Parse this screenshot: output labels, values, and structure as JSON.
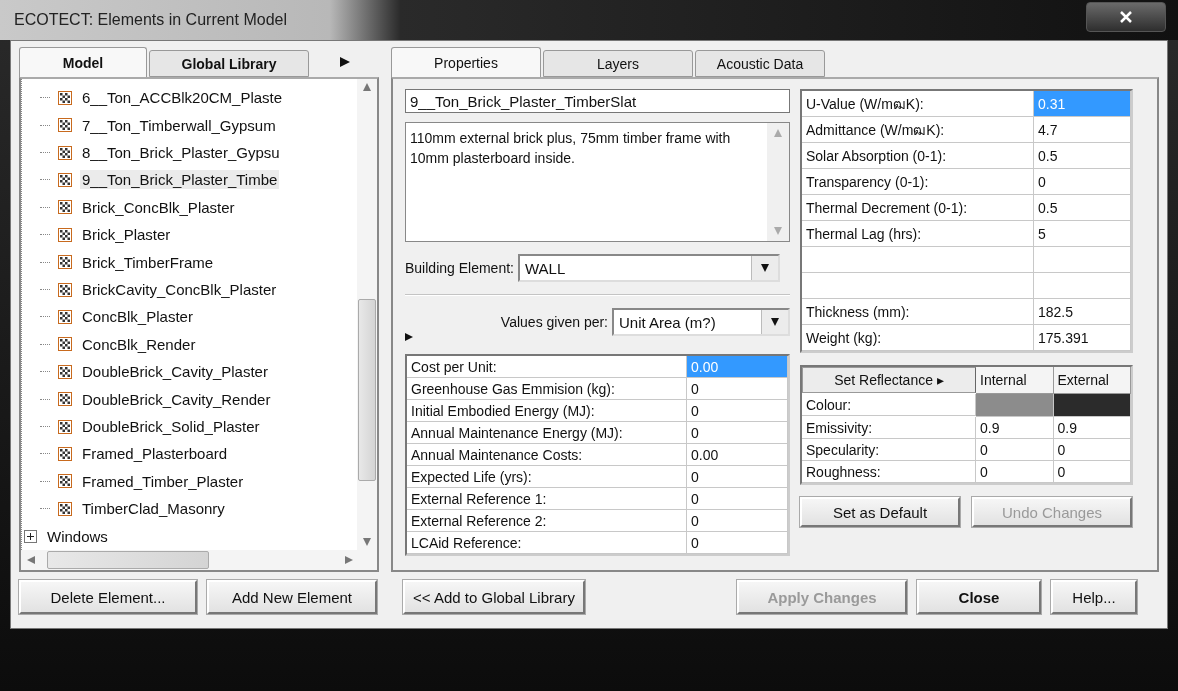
{
  "window": {
    "title": "ECOTECT: Elements in Current Model"
  },
  "left_tabs": [
    {
      "label": "Model",
      "selected": true
    },
    {
      "label": "Global Library",
      "selected": false
    }
  ],
  "tree": {
    "items": [
      {
        "kind": "element",
        "label": "6__Ton_ACCBlk20CM_Plaste",
        "selected": false
      },
      {
        "kind": "element",
        "label": "7__Ton_Timberwall_Gypsum",
        "selected": false
      },
      {
        "kind": "element",
        "label": "8__Ton_Brick_Plaster_Gypsu",
        "selected": false
      },
      {
        "kind": "element",
        "label": "9__Ton_Brick_Plaster_Timbe",
        "selected": true
      },
      {
        "kind": "element",
        "label": "Brick_ConcBlk_Plaster",
        "selected": false
      },
      {
        "kind": "element",
        "label": "Brick_Plaster",
        "selected": false
      },
      {
        "kind": "element",
        "label": "Brick_TimberFrame",
        "selected": false
      },
      {
        "kind": "element",
        "label": "BrickCavity_ConcBlk_Plaster",
        "selected": false
      },
      {
        "kind": "element",
        "label": "ConcBlk_Plaster",
        "selected": false
      },
      {
        "kind": "element",
        "label": "ConcBlk_Render",
        "selected": false
      },
      {
        "kind": "element",
        "label": "DoubleBrick_Cavity_Plaster",
        "selected": false
      },
      {
        "kind": "element",
        "label": "DoubleBrick_Cavity_Render",
        "selected": false
      },
      {
        "kind": "element",
        "label": "DoubleBrick_Solid_Plaster",
        "selected": false
      },
      {
        "kind": "element",
        "label": "Framed_Plasterboard",
        "selected": false
      },
      {
        "kind": "element",
        "label": "Framed_Timber_Plaster",
        "selected": false
      },
      {
        "kind": "element",
        "label": "TimberClad_Masonry",
        "selected": false
      },
      {
        "kind": "folder",
        "label": "Windows",
        "expanded": false
      }
    ]
  },
  "right_tabs": [
    {
      "label": "Properties",
      "selected": true
    },
    {
      "label": "Layers",
      "selected": false
    },
    {
      "label": "Acoustic Data",
      "selected": false
    }
  ],
  "properties": {
    "name": "9__Ton_Brick_Plaster_TimberSlat",
    "description": "110mm external brick plus, 75mm timber frame with 10mm plasterboard inside.",
    "building_element": {
      "label": "Building Element:",
      "value": "WALL"
    },
    "values_given_per": {
      "label": "Values given per:",
      "value": "Unit Area (m?)"
    },
    "cost_rows": [
      {
        "label": "Cost per Unit:",
        "value": "0.00",
        "selected": true
      },
      {
        "label": "Greenhouse Gas Emmision (kg):",
        "value": "0",
        "selected": false
      },
      {
        "label": "Initial Embodied Energy (MJ):",
        "value": "0",
        "selected": false
      },
      {
        "label": "Annual Maintenance Energy (MJ):",
        "value": "0",
        "selected": false
      },
      {
        "label": "Annual Maintenance Costs:",
        "value": "0.00",
        "selected": false
      },
      {
        "label": "Expected Life (yrs):",
        "value": "0",
        "selected": false
      },
      {
        "label": "External Reference 1:",
        "value": "0",
        "selected": false
      },
      {
        "label": "External Reference 2:",
        "value": "0",
        "selected": false
      },
      {
        "label": "LCAid Reference:",
        "value": "0",
        "selected": false
      }
    ],
    "thermal_rows": [
      {
        "kind": "value",
        "label": "U-Value (W/mฒK):",
        "value": "0.31",
        "selected": true
      },
      {
        "kind": "value",
        "label": "Admittance (W/mฒK):",
        "value": "4.7",
        "selected": false
      },
      {
        "kind": "value",
        "label": "Solar Absorption (0-1):",
        "value": "0.5",
        "selected": false
      },
      {
        "kind": "value",
        "label": "Transparency (0-1):",
        "value": "0",
        "selected": false
      },
      {
        "kind": "value",
        "label": "Thermal Decrement (0-1):",
        "value": "0.5",
        "selected": false
      },
      {
        "kind": "value",
        "label": "Thermal Lag (hrs):",
        "value": "5",
        "selected": false
      },
      {
        "kind": "blank",
        "selected": false
      },
      {
        "kind": "blank",
        "selected": false
      },
      {
        "kind": "value",
        "label": "Thickness (mm):",
        "value": "182.5",
        "selected": false
      },
      {
        "kind": "value",
        "label": "Weight (kg):",
        "value": "175.391",
        "selected": false
      }
    ],
    "reflectance": {
      "button": "Set Reflectance ▸",
      "columns": [
        "Internal",
        "External"
      ],
      "rows": [
        {
          "kind": "colour",
          "label": "Colour:",
          "swatches": [
            {
              "color": "#8c8c8c"
            },
            {
              "color": "#2b2b2b"
            }
          ]
        },
        {
          "kind": "value",
          "label": "Emissivity:",
          "internal": "0.9",
          "external": "0.9"
        },
        {
          "kind": "value",
          "label": "Specularity:",
          "internal": "0",
          "external": "0"
        },
        {
          "kind": "value",
          "label": "Roughness:",
          "internal": "0",
          "external": "0"
        }
      ]
    },
    "panel_buttons": [
      {
        "label": "Set as Default",
        "disabled": false
      },
      {
        "label": "Undo Changes",
        "disabled": true
      }
    ]
  },
  "bottom_buttons": {
    "left": [
      {
        "label": "Delete Element...",
        "disabled": false,
        "bold": false
      },
      {
        "label": "Add New Element",
        "disabled": false,
        "bold": false
      }
    ],
    "middle": [
      {
        "label": "<< Add to Global Library",
        "disabled": false,
        "bold": false
      }
    ],
    "right": [
      {
        "label": "Apply Changes",
        "disabled": true,
        "bold": true
      },
      {
        "label": "Close",
        "disabled": false,
        "bold": true
      },
      {
        "label": "Help...",
        "disabled": false,
        "bold": false
      }
    ]
  }
}
